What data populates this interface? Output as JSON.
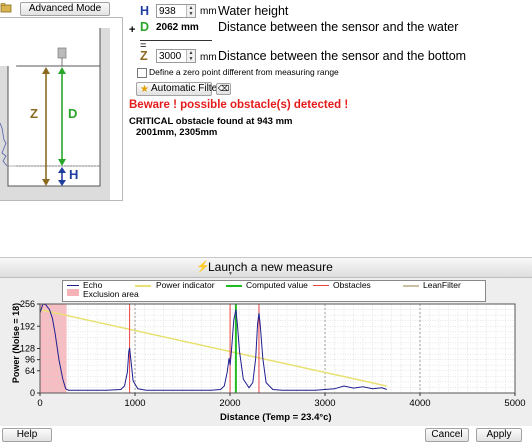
{
  "top": {
    "advanced_mode_label": "Advanced Mode"
  },
  "schema": {
    "z_label": "Z",
    "d_label": "D",
    "h_label": "H"
  },
  "params": {
    "h_letter": "H",
    "water_height_value": "938",
    "water_height_unit": "mm",
    "water_height_label": "Water height",
    "plus_sign": "+",
    "d_letter": "D",
    "d_value": "2062 mm",
    "d_label": "Distance between the sensor and the water",
    "equals_sign": "=",
    "z_letter": "Z",
    "z_value": "3000",
    "z_unit": "mm",
    "z_label": "Distance between the sensor and the bottom",
    "zero_point_label": "Define a zero point different from measuring range",
    "zero_point_checked": false,
    "auto_filter_label": "Automatic Filter"
  },
  "warnings": {
    "beware": "Beware ! possible obstacle(s) detected !",
    "critical": "CRITICAL obstacle found at 943 mm",
    "distances": "2001mm, 2305mm"
  },
  "launch_label": "Launch a new measure",
  "legend": {
    "echo": "Echo",
    "power_indicator": "Power indicator",
    "computed_value": "Computed value",
    "obstacles": "Obstacles",
    "leanfilter": "LeanFilter",
    "exclusion_area": "Exclusion area"
  },
  "colors": {
    "accent_green": "#2aa62a",
    "accent_red": "#e41b1b",
    "echo": "#1f1f8f",
    "power_indicator": "#e8e070",
    "computed_value": "#22bb22",
    "obstacles": "#ee4444",
    "leanfilter": "#c8c0a0",
    "exclusion_area": "#f5b3b8"
  },
  "chart_data": {
    "type": "line",
    "xlabel": "Distance (Temp = 23.4°c)",
    "ylabel": "Power (Noise = 18)",
    "xlim": [
      0,
      5000
    ],
    "ylim": [
      0,
      256
    ],
    "x_ticks": [
      0,
      1000,
      2000,
      3000,
      4000,
      5000
    ],
    "y_ticks": [
      0,
      64,
      96,
      128,
      192,
      256
    ],
    "grid": true,
    "legend_position": "top",
    "exclusion_area": [
      0,
      280
    ],
    "computed_value": 2062,
    "obstacles": [
      943,
      2001,
      2305
    ],
    "power_indicator": {
      "x": [
        0,
        3650
      ],
      "y": [
        240,
        20
      ]
    },
    "series": [
      {
        "name": "Echo",
        "x": [
          0,
          30,
          60,
          100,
          130,
          160,
          200,
          240,
          270,
          300,
          360,
          500,
          700,
          850,
          890,
          920,
          935,
          943,
          955,
          980,
          1030,
          1120,
          1200,
          1300,
          1400,
          1500,
          1600,
          1700,
          1800,
          1900,
          1940,
          1970,
          1990,
          2001,
          2015,
          2040,
          2062,
          2080,
          2100,
          2140,
          2200,
          2240,
          2270,
          2290,
          2305,
          2320,
          2345,
          2380,
          2450,
          2550,
          2700,
          2900,
          3100,
          3200,
          3300,
          3400,
          3500,
          3600,
          3650
        ],
        "y": [
          230,
          256,
          254,
          240,
          215,
          170,
          95,
          40,
          12,
          8,
          8,
          8,
          8,
          10,
          20,
          60,
          120,
          130,
          100,
          35,
          12,
          8,
          8,
          8,
          8,
          8,
          8,
          8,
          8,
          10,
          20,
          60,
          100,
          80,
          120,
          210,
          240,
          190,
          120,
          40,
          15,
          30,
          100,
          200,
          230,
          190,
          100,
          30,
          10,
          8,
          8,
          8,
          12,
          20,
          14,
          18,
          12,
          15,
          10
        ]
      }
    ]
  },
  "bottom": {
    "help_label": "Help",
    "cancel_label": "Cancel",
    "apply_label": "Apply"
  }
}
